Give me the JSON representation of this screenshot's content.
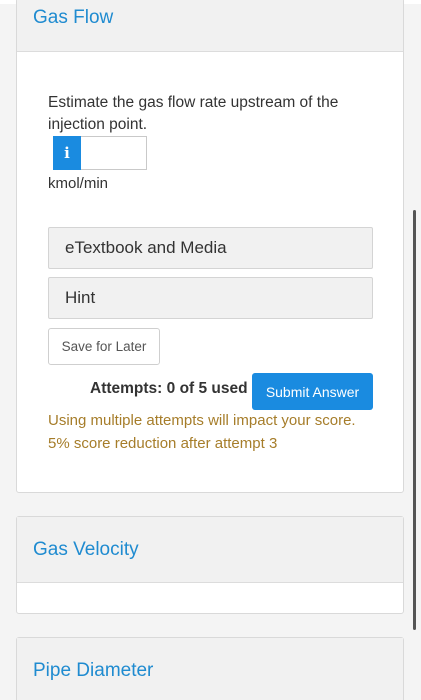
{
  "sections": [
    {
      "title": "Gas Flow",
      "question": "Estimate the gas flow rate upstream of the injection point.",
      "info_icon": "i",
      "answer_value": "",
      "unit": "kmol/min",
      "resources": [
        "eTextbook and Media",
        "Hint"
      ],
      "save_label": "Save for Later",
      "attempts": "Attempts: 0 of 5 used",
      "submit_label": "Submit Answer",
      "warning_line1": "Using multiple attempts will impact your score.",
      "warning_line2": "5% score reduction after attempt 3"
    },
    {
      "title": "Gas Velocity"
    },
    {
      "title": "Pipe Diameter"
    }
  ],
  "colors": {
    "accent": "#1a8be0",
    "heading": "#1f8bd0",
    "warning": "#a67d2a"
  }
}
